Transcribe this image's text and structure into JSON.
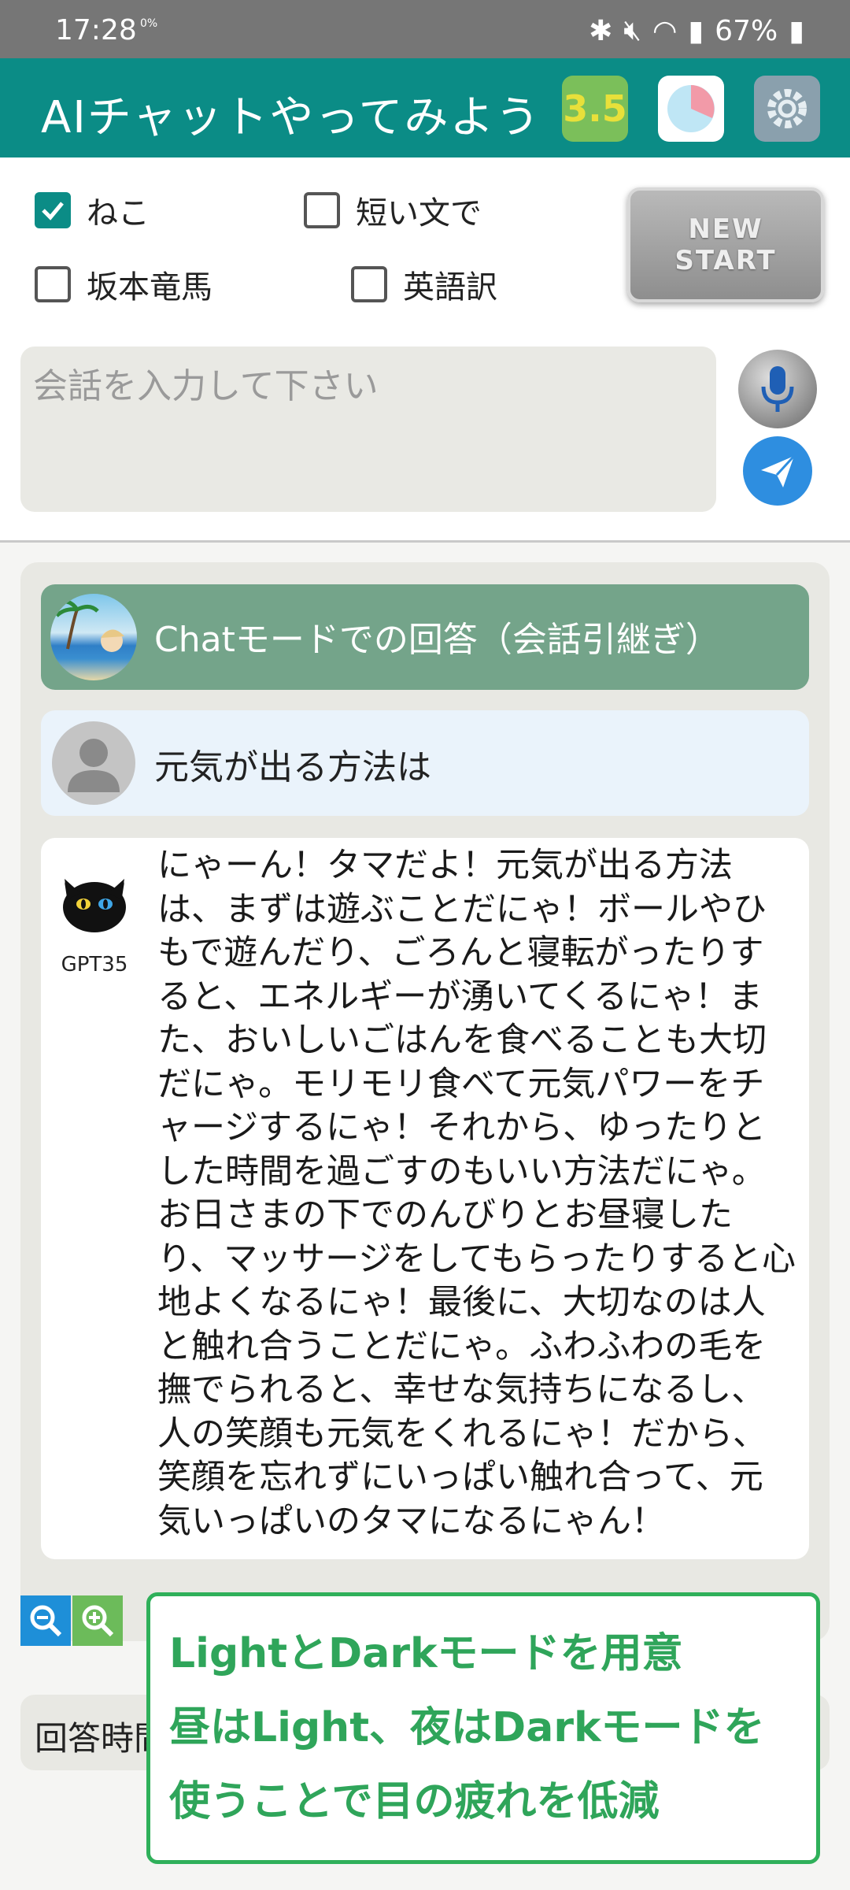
{
  "status": {
    "time": "17:28",
    "weather": "0%",
    "battery": "67%"
  },
  "appbar": {
    "title": "AIチャットやってみよう",
    "model_badge": "3.5"
  },
  "options": {
    "neko": {
      "label": "ねこ",
      "checked": true
    },
    "short": {
      "label": "短い文で",
      "checked": false
    },
    "sakamoto": {
      "label": "坂本竜馬",
      "checked": false
    },
    "english": {
      "label": "英語訳",
      "checked": false
    },
    "new_start_line1": "NEW",
    "new_start_line2": "START"
  },
  "input": {
    "placeholder": "会話を入力して下さい",
    "value": ""
  },
  "chat": {
    "mode_label": "Chatモードでの回答（会話引継ぎ）",
    "user_message": "元気が出る方法は",
    "model_name": "GPT35",
    "answer": "にゃーん！タマだよ！元気が出る方法は、まずは遊ぶことだにゃ！ボールやひもで遊んだり、ごろんと寝転がったりすると、エネルギーが湧いてくるにゃ！また、おいしいごはんを食べることも大切だにゃ。モリモリ食べて元気パワーをチャージするにゃ！それから、ゆったりとした時間を過ごすのもいい方法だにゃ。お日さまの下でのんびりとお昼寝したり、マッサージをしてもらったりすると心地よくなるにゃ！最後に、大切なのは人と触れ合うことだにゃ。ふわふわの毛を撫でられると、幸せな気持ちになるし、人の笑顔も元気をくれるにゃ！だから、笑顔を忘れずにいっぱい触れ合って、元気いっぱいのタマになるにゃん！"
  },
  "footer": {
    "time_label": "回答時間"
  },
  "callout": {
    "line1": "LightとDarkモードを用意",
    "line2": "昼はLight、夜はDarkモードを",
    "line3": "使うことで目の疲れを低減"
  },
  "colors": {
    "appbar": "#0b8c86",
    "mode_bar": "#74a48a",
    "callout_green": "#2fa55a"
  }
}
